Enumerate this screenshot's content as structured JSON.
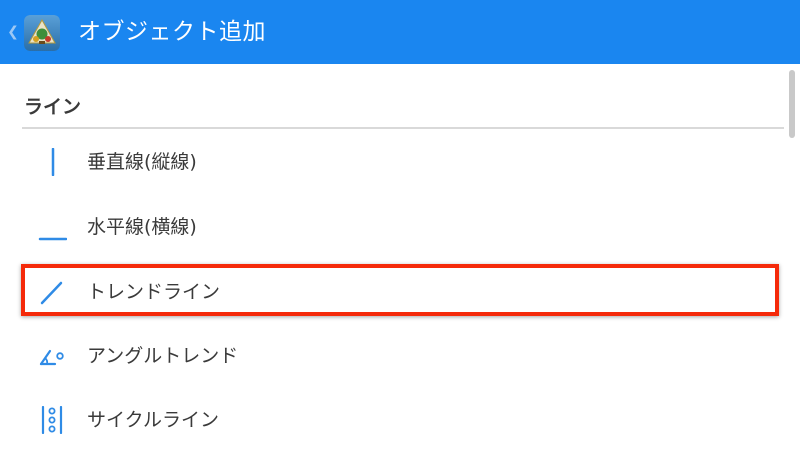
{
  "header": {
    "title": "オブジェクト追加",
    "back_glyph": "❮",
    "background_color": "#1a86f0",
    "logo_icon": "metatrader-app-icon"
  },
  "section": {
    "title": "ライン"
  },
  "items": [
    {
      "label": "垂直線(縦線)",
      "icon": "vertical-line-icon"
    },
    {
      "label": "水平線(横線)",
      "icon": "horizontal-line-icon"
    },
    {
      "label": "トレンドライン",
      "icon": "trend-line-icon",
      "highlighted": true
    },
    {
      "label": "アングルトレンド",
      "icon": "angle-trend-icon"
    },
    {
      "label": "サイクルライン",
      "icon": "cycle-line-icon"
    }
  ],
  "colors": {
    "accent": "#1a86f0",
    "icon": "#2f8be6",
    "highlight": "#f52a0a",
    "text": "#3a3a3a"
  }
}
